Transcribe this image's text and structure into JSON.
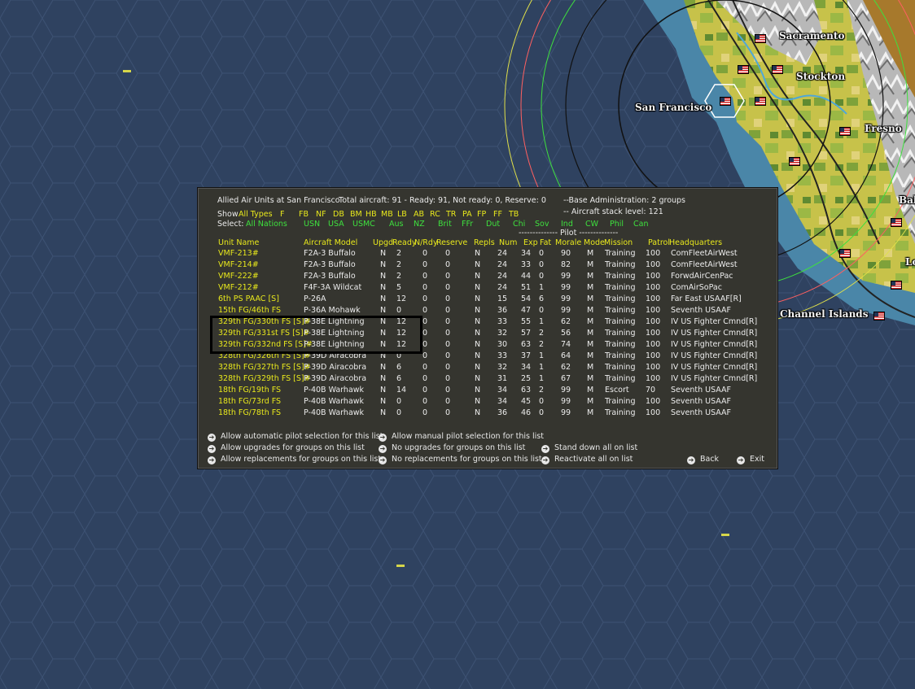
{
  "map": {
    "cities": [
      "Sacramento",
      "Stockton",
      "San Francisco",
      "Fresno",
      "Channel Islands",
      "Bak",
      "Lo"
    ]
  },
  "panel": {
    "title": "Allied Air Units at San Francisco",
    "totals": "Total aircraft: 91 - Ready: 91, Not ready: 0, Reserve: 0",
    "base_admin": "--Base Administration: 2 groups",
    "stack_level": "-- Aircraft stack level: 121",
    "show_label": "Show",
    "show_items": [
      "All Types",
      "F",
      "FB",
      "NF",
      "DB",
      "BM",
      "HB",
      "MB",
      "LB",
      "AB",
      "RC",
      "TR",
      "PA",
      "FP",
      "FF",
      "TB"
    ],
    "select_label": "Select:",
    "select_items": [
      "All Nations",
      "USN",
      "USA",
      "USMC",
      "Aus",
      "NZ",
      "Brit",
      "FFr",
      "Dut",
      "Chi",
      "Sov",
      "Ind",
      "CW",
      "Phil",
      "Can"
    ],
    "pilot_divider": "-------------- Pilot --------------",
    "columns": [
      "Unit Name",
      "Aircraft Model",
      "Upgd",
      "Ready",
      "N/Rdy",
      "Reserve",
      "Repls",
      "Num",
      "Exp",
      "Fat",
      "Morale",
      "Mode",
      "Mission",
      "Patrol",
      "Headquarters"
    ],
    "rows": [
      [
        "VMF-213#",
        "F2A-3 Buffalo",
        "N",
        "2",
        "0",
        "0",
        "N",
        "24",
        "34",
        "0",
        "90",
        "M",
        "Training",
        "100",
        "ComFleetAirWest"
      ],
      [
        "VMF-214#",
        "F2A-3 Buffalo",
        "N",
        "2",
        "0",
        "0",
        "N",
        "24",
        "33",
        "0",
        "82",
        "M",
        "Training",
        "100",
        "ComFleetAirWest"
      ],
      [
        "VMF-222#",
        "F2A-3 Buffalo",
        "N",
        "2",
        "0",
        "0",
        "N",
        "24",
        "44",
        "0",
        "99",
        "M",
        "Training",
        "100",
        "ForwdAirCenPac"
      ],
      [
        "VMF-212#",
        "F4F-3A Wildcat",
        "N",
        "5",
        "0",
        "0",
        "N",
        "24",
        "51",
        "1",
        "99",
        "M",
        "Training",
        "100",
        "ComAirSoPac"
      ],
      [
        "6th PS PAAC [S]",
        "P-26A",
        "N",
        "12",
        "0",
        "0",
        "N",
        "15",
        "54",
        "6",
        "99",
        "M",
        "Training",
        "100",
        "Far East USAAF[R]"
      ],
      [
        "15th FG/46th FS",
        "P-36A Mohawk",
        "N",
        "0",
        "0",
        "0",
        "N",
        "36",
        "47",
        "0",
        "99",
        "M",
        "Training",
        "100",
        "Seventh USAAF"
      ],
      [
        "329th FG/330th FS [S]#",
        "P-38E Lightning",
        "N",
        "12",
        "0",
        "0",
        "N",
        "33",
        "55",
        "1",
        "62",
        "M",
        "Training",
        "100",
        "IV US Fighter Cmnd[R]"
      ],
      [
        "329th FG/331st FS [S]#",
        "P-38E Lightning",
        "N",
        "12",
        "0",
        "0",
        "N",
        "32",
        "57",
        "2",
        "56",
        "M",
        "Training",
        "100",
        "IV US Fighter Cmnd[R]"
      ],
      [
        "329th FG/332nd FS [S]#",
        "P-38E Lightning",
        "N",
        "12",
        "0",
        "0",
        "N",
        "30",
        "63",
        "2",
        "74",
        "M",
        "Training",
        "100",
        "IV US Fighter Cmnd[R]"
      ],
      [
        "328th FG/326th FS [S]#",
        "P-39D Airacobra",
        "N",
        "0",
        "0",
        "0",
        "N",
        "33",
        "37",
        "1",
        "64",
        "M",
        "Training",
        "100",
        "IV US Fighter Cmnd[R]"
      ],
      [
        "328th FG/327th FS [S]#",
        "P-39D Airacobra",
        "N",
        "6",
        "0",
        "0",
        "N",
        "32",
        "34",
        "1",
        "62",
        "M",
        "Training",
        "100",
        "IV US Fighter Cmnd[R]"
      ],
      [
        "328th FG/329th FS [S]#",
        "P-39D Airacobra",
        "N",
        "6",
        "0",
        "0",
        "N",
        "31",
        "25",
        "1",
        "67",
        "M",
        "Training",
        "100",
        "IV US Fighter Cmnd[R]"
      ],
      [
        "18th FG/19th FS",
        "P-40B Warhawk",
        "N",
        "14",
        "0",
        "0",
        "N",
        "34",
        "63",
        "2",
        "99",
        "M",
        "Escort",
        "70",
        "Seventh USAAF"
      ],
      [
        "18th FG/73rd FS",
        "P-40B Warhawk",
        "N",
        "0",
        "0",
        "0",
        "N",
        "34",
        "45",
        "0",
        "99",
        "M",
        "Training",
        "100",
        "Seventh USAAF"
      ],
      [
        "18th FG/78th FS",
        "P-40B Warhawk",
        "N",
        "0",
        "0",
        "0",
        "N",
        "36",
        "46",
        "0",
        "99",
        "M",
        "Training",
        "100",
        "Seventh USAAF"
      ]
    ],
    "options": {
      "auto_pilot": "Allow automatic pilot selection for this list",
      "manual_pilot": "Allow manual pilot selection for this list",
      "allow_upgrades": "Allow upgrades for groups on this list",
      "no_upgrades": "No upgrades for groups on this list",
      "stand_down": "Stand down all on list",
      "allow_repl": "Allow replacements for groups on this list",
      "no_repl": "No replacements for groups on this list",
      "reactivate": "Reactivate all on list",
      "back": "Back",
      "exit": "Exit"
    }
  }
}
